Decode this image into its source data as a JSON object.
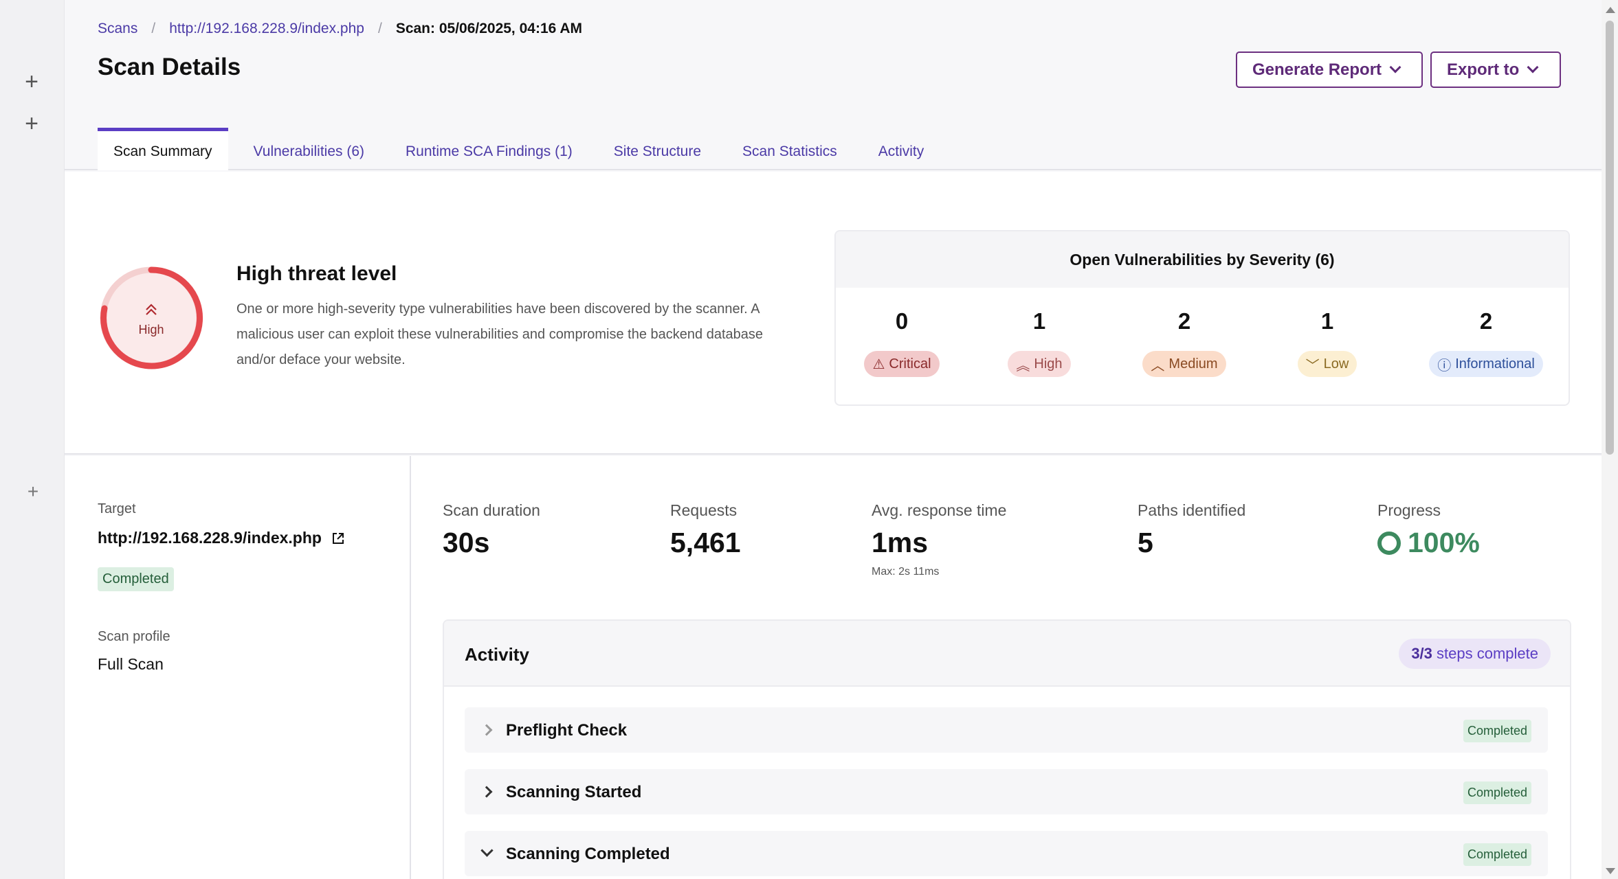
{
  "breadcrumb": {
    "scans": "Scans",
    "url": "http://192.168.228.9/index.php",
    "current": "Scan: 05/06/2025, 04:16 AM",
    "separator": "/"
  },
  "page": {
    "title": "Scan Details"
  },
  "header_buttons": {
    "generate_report": "Generate Report",
    "export_to": "Export to"
  },
  "tabs": [
    {
      "label": "Scan Summary",
      "active": true
    },
    {
      "label": "Vulnerabilities (6)",
      "active": false
    },
    {
      "label": "Runtime SCA Findings (1)",
      "active": false
    },
    {
      "label": "Site Structure",
      "active": false
    },
    {
      "label": "Scan Statistics",
      "active": false
    },
    {
      "label": "Activity",
      "active": false
    }
  ],
  "threat": {
    "ring_label": "High",
    "title": "High threat level",
    "description": "One or more high-severity type vulnerabilities have been discovered by the scanner. A malicious user can exploit these vulnerabilities and compromise the backend database and/or deface your website.",
    "color": "#e5484d"
  },
  "severity": {
    "title": "Open Vulnerabilities by Severity (6)",
    "items": [
      {
        "count": "0",
        "label": "Critical",
        "icon": "warning-triangle-icon"
      },
      {
        "count": "1",
        "label": "High",
        "icon": "double-chevron-up-icon"
      },
      {
        "count": "2",
        "label": "Medium",
        "icon": "chevron-up-icon"
      },
      {
        "count": "1",
        "label": "Low",
        "icon": "chevron-down-icon"
      },
      {
        "count": "2",
        "label": "Informational",
        "icon": "info-circle-icon"
      }
    ]
  },
  "details": {
    "target_label": "Target",
    "target_url": "http://192.168.228.9/index.php",
    "status": "Completed",
    "profile_label": "Scan profile",
    "profile_value": "Full Scan"
  },
  "stats": {
    "duration": {
      "label": "Scan duration",
      "value": "30s"
    },
    "requests": {
      "label": "Requests",
      "value": "5,461"
    },
    "response": {
      "label": "Avg. response time",
      "value": "1ms",
      "sub": "Max: 2s 11ms"
    },
    "paths": {
      "label": "Paths identified",
      "value": "5"
    },
    "progress": {
      "label": "Progress",
      "value": "100%",
      "fraction": 1.0
    }
  },
  "activity": {
    "title": "Activity",
    "steps_count": "3/3",
    "steps_text": "steps complete",
    "rows": [
      {
        "label": "Preflight Check",
        "status": "Completed",
        "expanded": false
      },
      {
        "label": "Scanning Started",
        "status": "Completed",
        "expanded": false
      },
      {
        "label": "Scanning Completed",
        "status": "Completed",
        "expanded": true
      }
    ]
  },
  "colors": {
    "accent": "#5b3ec4",
    "button": "#5e2a78",
    "success": "#3d8a5f"
  }
}
